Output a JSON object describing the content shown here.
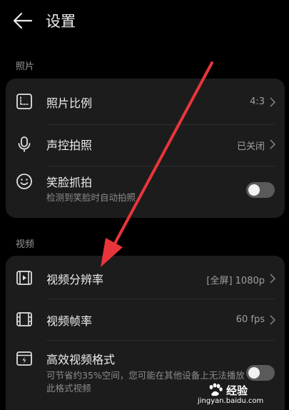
{
  "header": {
    "title": "设置"
  },
  "photo_section": {
    "label": "照片",
    "items": [
      {
        "label": "照片比例",
        "value": "4:3"
      },
      {
        "label": "声控拍照",
        "value": "已关闭"
      },
      {
        "label": "笑脸抓拍",
        "subtitle": "检测到笑脸时自动拍照",
        "toggle_on": false
      }
    ]
  },
  "video_section": {
    "label": "视频",
    "items": [
      {
        "label": "视频分辨率",
        "value": "[全屏] 1080p"
      },
      {
        "label": "视频帧率",
        "value": "60 fps"
      },
      {
        "label": "高效视频格式",
        "subtitle": "可节省约35%空间，您可能在其他设备上无法播放此格式视频",
        "toggle_on": false
      }
    ]
  },
  "watermark": {
    "brand": "经验",
    "url": "jingyan.baidu.com"
  },
  "colors": {
    "background": "#000000",
    "card": "#1c1c1c",
    "annotation_arrow": "#e8353a"
  }
}
